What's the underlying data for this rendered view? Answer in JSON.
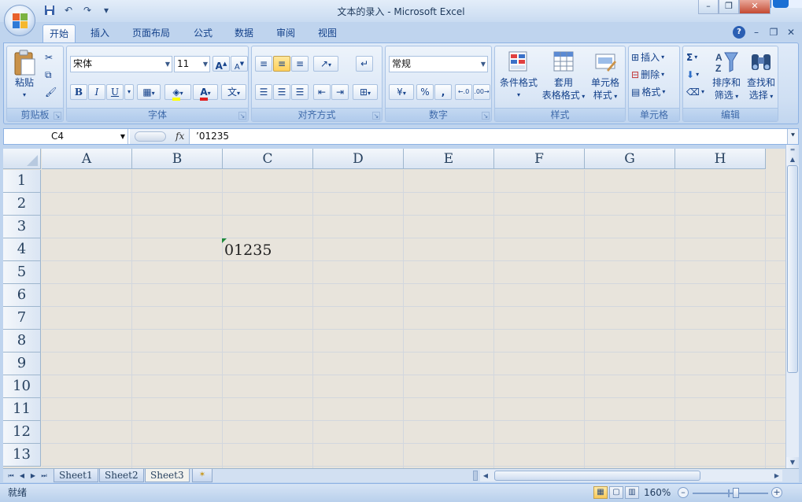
{
  "window": {
    "title": "文本的录入 - Microsoft Excel"
  },
  "quick_access": {
    "icons": [
      "save-icon",
      "undo-icon",
      "redo-icon",
      "customize-icon"
    ]
  },
  "tabs": [
    "开始",
    "插入",
    "页面布局",
    "公式",
    "数据",
    "审阅",
    "视图"
  ],
  "active_tab": "开始",
  "ribbon": {
    "clipboard": {
      "label": "剪贴板",
      "paste": "粘贴"
    },
    "font": {
      "label": "字体",
      "font_name": "宋体",
      "font_size": "11",
      "bold": "B",
      "italic": "I",
      "underline": "U",
      "font_color_glyph": "A",
      "phonetic_glyph": "文"
    },
    "alignment": {
      "label": "对齐方式"
    },
    "number": {
      "label": "数字",
      "format": "常规",
      "percent": "%",
      "comma": ","
    },
    "styles": {
      "label": "样式",
      "conditional_format": "条件格式",
      "table_format_line1": "套用",
      "table_format_line2": "表格格式",
      "cell_style_line1": "单元格",
      "cell_style_line2": "样式"
    },
    "cells": {
      "label": "单元格",
      "insert": "插入",
      "delete": "删除",
      "format": "格式"
    },
    "editing": {
      "label": "编辑",
      "sum_glyph": "Σ",
      "sort_filter_line1": "排序和",
      "sort_filter_line2": "筛选",
      "find_select_line1": "查找和",
      "find_select_line2": "选择"
    }
  },
  "formula_bar": {
    "name_box": "C4",
    "fx": "fx",
    "formula": "’01235"
  },
  "grid": {
    "columns": [
      "A",
      "B",
      "C",
      "D",
      "E",
      "F",
      "G",
      "H"
    ],
    "rows": [
      "1",
      "2",
      "3",
      "4",
      "5",
      "6",
      "7",
      "8",
      "9",
      "10",
      "11",
      "12",
      "13"
    ],
    "cells": [
      {
        "ref": "C4",
        "value": "01235"
      }
    ]
  },
  "sheets": [
    "Sheet1",
    "Sheet2",
    "Sheet3"
  ],
  "active_sheet": "Sheet3",
  "status": {
    "text": "就绪",
    "zoom": "160%",
    "zoom_level": 160
  },
  "colors": {
    "ribbon_bg": "#cfdff3",
    "grid_bg": "#e8e4dc",
    "accent": "#15428b",
    "error_indicator": "#1f8a3a"
  }
}
